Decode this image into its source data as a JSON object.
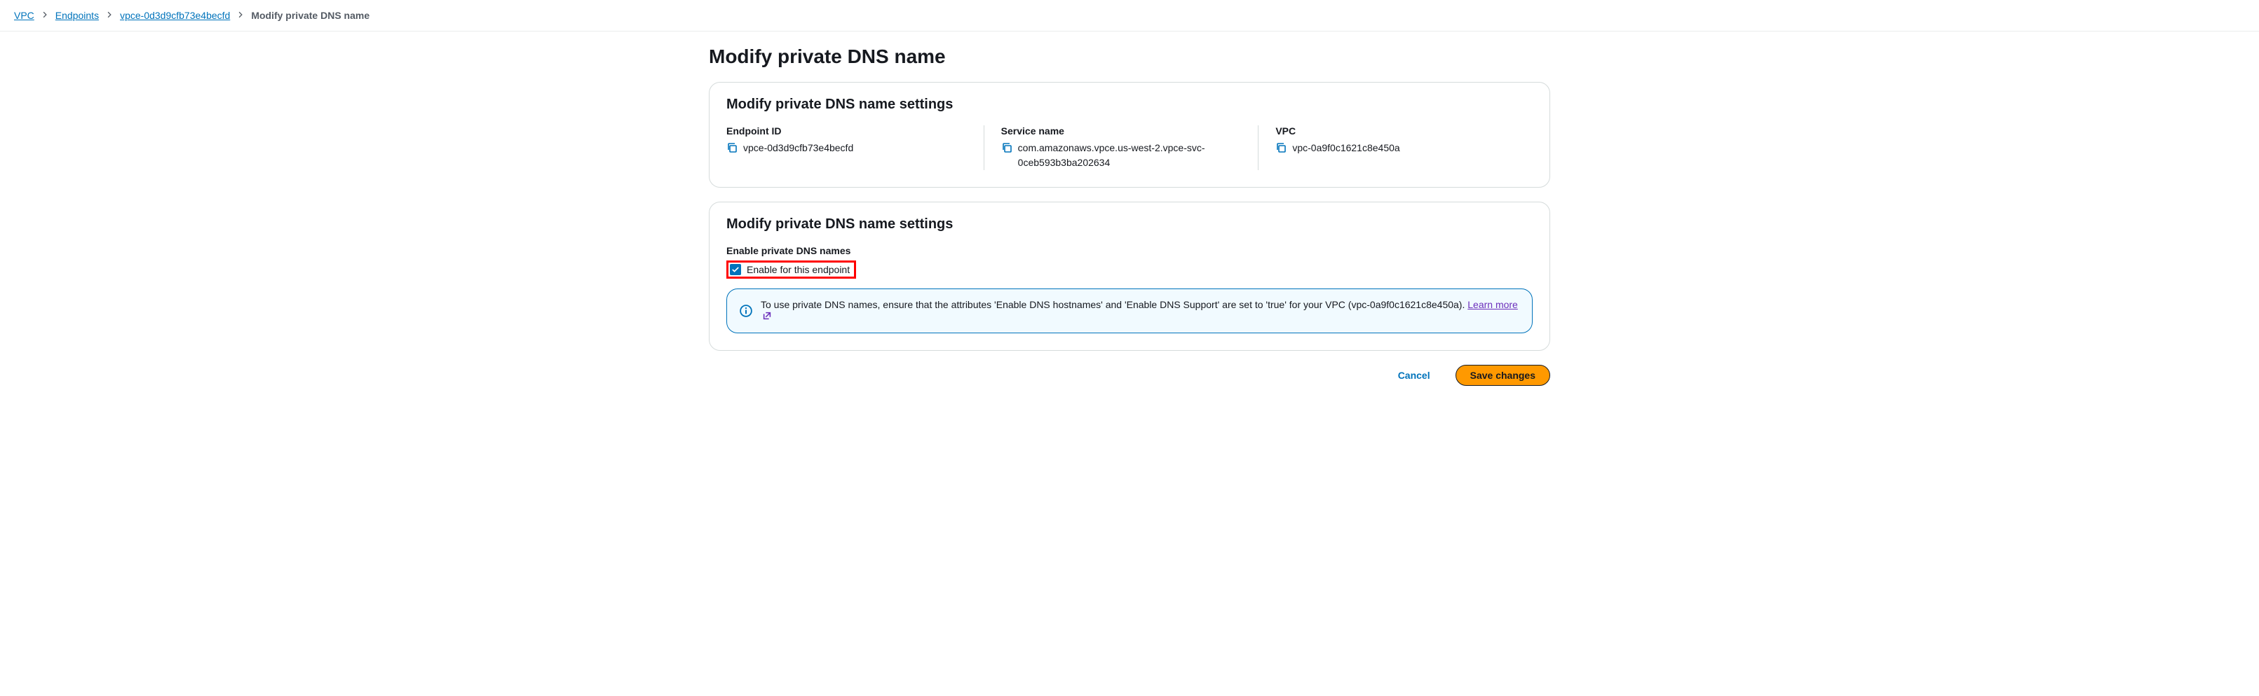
{
  "breadcrumb": {
    "items": [
      "VPC",
      "Endpoints",
      "vpce-0d3d9cfb73e4becfd"
    ],
    "current": "Modify private DNS name"
  },
  "page": {
    "title": "Modify private DNS name"
  },
  "panel1": {
    "title": "Modify private DNS name settings",
    "endpoint_id": {
      "label": "Endpoint ID",
      "value": "vpce-0d3d9cfb73e4becfd"
    },
    "service_name": {
      "label": "Service name",
      "value": "com.amazonaws.vpce.us-west-2.vpce-svc-0ceb593b3ba202634"
    },
    "vpc": {
      "label": "VPC",
      "value": "vpc-0a9f0c1621c8e450a"
    }
  },
  "panel2": {
    "title": "Modify private DNS name settings",
    "field_label": "Enable private DNS names",
    "checkbox_label": "Enable for this endpoint",
    "checkbox_checked": true,
    "info_text": "To use private DNS names, ensure that the attributes 'Enable DNS hostnames' and 'Enable DNS Support' are set to 'true' for your VPC (vpc-0a9f0c1621c8e450a). ",
    "learn_more": "Learn more"
  },
  "buttons": {
    "cancel": "Cancel",
    "save": "Save changes"
  }
}
